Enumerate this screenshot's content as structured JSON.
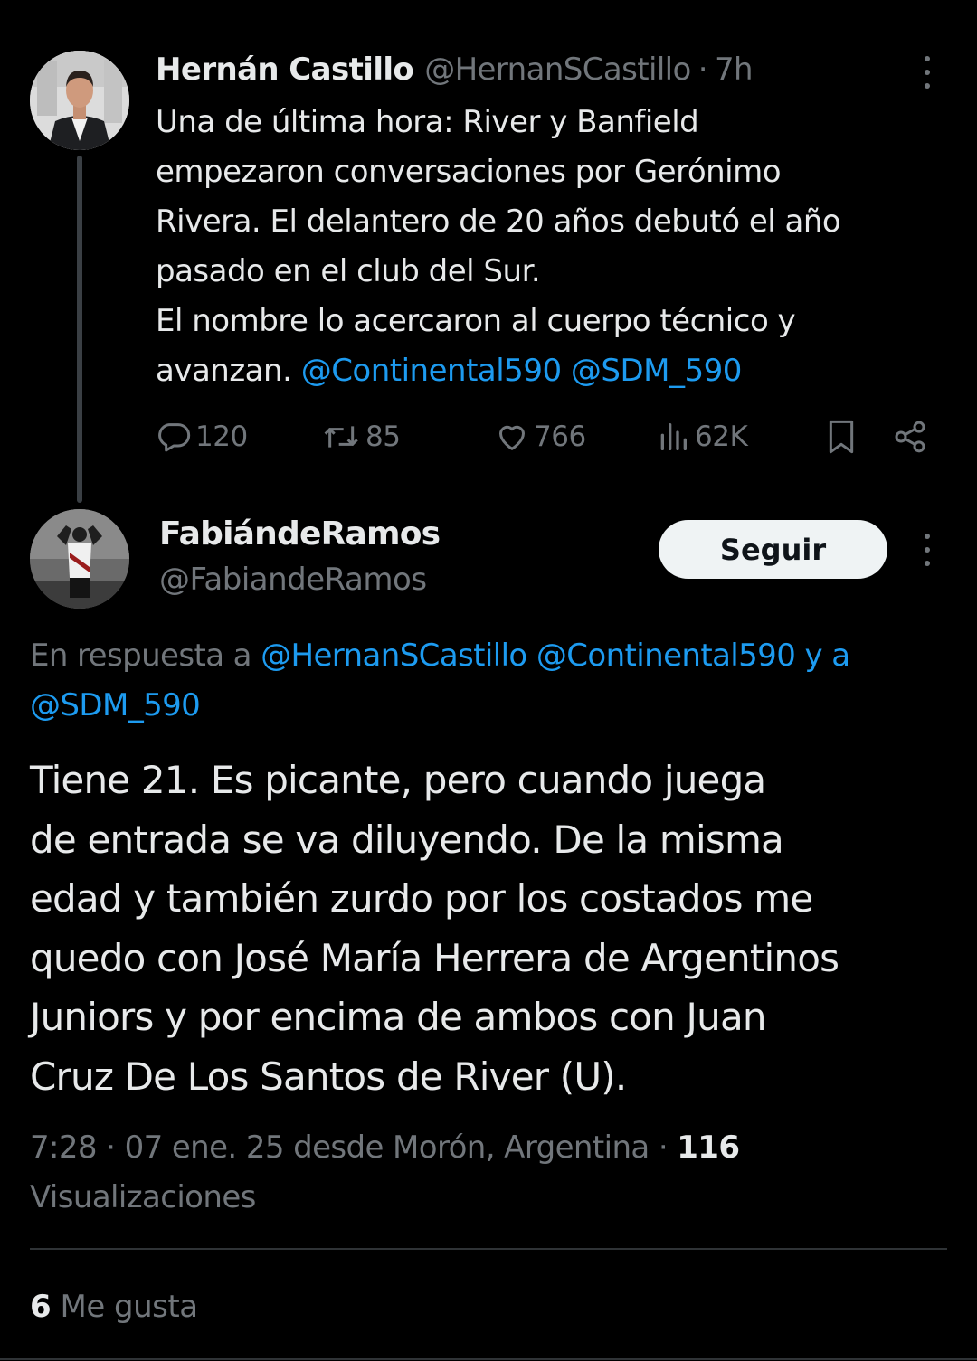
{
  "parent_tweet": {
    "author_name": "Hernán Castillo",
    "author_handle": "@HernanSCastillo",
    "separator": "·",
    "time_ago": "7h",
    "text_lines": [
      "Una de última hora: River y Banfield",
      "empezaron conversaciones por Gerónimo",
      "Rivera. El delantero de 20 años debutó el año",
      "pasado en el club del Sur.",
      "El nombre lo acercaron al cuerpo técnico y"
    ],
    "text_last_prefix": "avanzan. ",
    "mentions": [
      "@Continental590",
      "@SDM_590"
    ],
    "stats": {
      "replies": "120",
      "reposts": "85",
      "likes": "766",
      "views": "62K"
    }
  },
  "reply_tweet": {
    "author_name": "FabiándeRamos",
    "author_handle": "@FabiandeRamos",
    "follow_label": "Seguir",
    "in_reply_prefix": "En respuesta a ",
    "in_reply_mentions": [
      "@HernanSCastillo",
      "@Continental590",
      "@SDM_590"
    ],
    "in_reply_conjunction": " y a",
    "text_lines": [
      "Tiene 21. Es picante, pero cuando juega",
      "de entrada se va diluyendo. De la misma",
      "edad y también zurdo por los costados me",
      "quedo con José María Herrera de Argentinos",
      "Juniors y por encima de ambos con Juan",
      "Cruz De Los Santos de River (U)."
    ],
    "timestamp": "7:28 · 07 ene. 25 desde Morón, Argentina · ",
    "views_count": "116",
    "views_label": "Visualizaciones",
    "likes_count": "6",
    "likes_label": " Me gusta"
  },
  "icons": {
    "more": "more-vertical-icon",
    "reply": "reply-bubble-icon",
    "repost": "repost-icon",
    "like": "heart-icon",
    "views": "views-chart-icon",
    "bookmark": "bookmark-icon",
    "share": "share-icon"
  },
  "colors": {
    "background": "#000000",
    "text": "#e7e9ea",
    "secondary": "#71767b",
    "link": "#1d9bf0",
    "thread_line": "#3a3f44",
    "divider": "#2f3336",
    "follow_bg": "#eff3f4"
  }
}
